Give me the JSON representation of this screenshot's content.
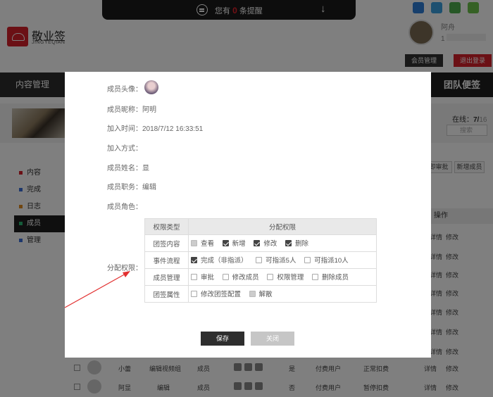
{
  "topbar": {
    "notice_prefix": "您有",
    "notice_count": "0",
    "notice_suffix": "条提醒"
  },
  "brand": {
    "name": "敬业签",
    "sub": "JINGYEQIAN"
  },
  "user": {
    "name": "阿舟",
    "id_prefix": "1",
    "member_btn": "会员管理",
    "logout_btn": "退出登录"
  },
  "nav": {
    "content": "内容管理",
    "team": "团队便签"
  },
  "banner": {
    "online_label": "在线：",
    "online_value": "7/",
    "online_total": "16",
    "search_placeholder": "搜索"
  },
  "side_menu": [
    {
      "label": "内容",
      "color": "#d6202a"
    },
    {
      "label": "完成",
      "color": "#3b6fd8"
    },
    {
      "label": "日志",
      "color": "#e08a1e"
    },
    {
      "label": "成员",
      "color": "#2bb673"
    },
    {
      "label": "管理",
      "color": "#3b6fd8"
    }
  ],
  "buttons": {
    "review": "即审批",
    "add_member": "新增成员"
  },
  "table": {
    "action_header": "操作",
    "detail": "详情",
    "modify": "修改"
  },
  "rows": [
    {
      "name": "小蕾",
      "role": "编辑视频组",
      "type": "成员",
      "flag": "是",
      "user_type": "付费用户",
      "status": "正常扣费"
    },
    {
      "name": "阿显",
      "role": "编辑",
      "type": "成员",
      "flag": "否",
      "user_type": "付费用户",
      "status": "暂停扣费"
    }
  ],
  "modal": {
    "avatar_label": "成员头像：",
    "nickname_label": "成员昵称：",
    "nickname": "阿明",
    "join_time_label": "加入时间：",
    "join_time": "2018/7/12 16:33:51",
    "join_method_label": "加入方式：",
    "join_method": "",
    "realname_label": "成员姓名：",
    "realname": "显",
    "position_label": "成员职务：",
    "position": "编辑",
    "role_label": "成员角色：",
    "role": "",
    "perm_label": "分配权限：",
    "perm_head_type": "权限类型",
    "perm_head_assign": "分配权限",
    "perms": [
      {
        "type": "团签内容",
        "opts": [
          {
            "label": "查看",
            "state": "dim"
          },
          {
            "label": "新增",
            "state": "on"
          },
          {
            "label": "修改",
            "state": "on"
          },
          {
            "label": "删除",
            "state": "on"
          }
        ]
      },
      {
        "type": "事件流程",
        "opts": [
          {
            "label": "完成（非指派）",
            "state": "on"
          },
          {
            "label": "可指派5人",
            "state": "off"
          },
          {
            "label": "可指派10人",
            "state": "off"
          }
        ]
      },
      {
        "type": "成员管理",
        "opts": [
          {
            "label": "审批",
            "state": "off"
          },
          {
            "label": "修改成员",
            "state": "off"
          },
          {
            "label": "权限管理",
            "state": "off"
          },
          {
            "label": "删除成员",
            "state": "off"
          }
        ]
      },
      {
        "type": "团签属性",
        "opts": [
          {
            "label": "修改团签配置",
            "state": "off"
          },
          {
            "label": "解散",
            "state": "dim"
          }
        ]
      }
    ],
    "save": "保存",
    "close": "关闭"
  },
  "colors": {
    "accent": "#d6202a",
    "dark": "#1e1e1e"
  }
}
